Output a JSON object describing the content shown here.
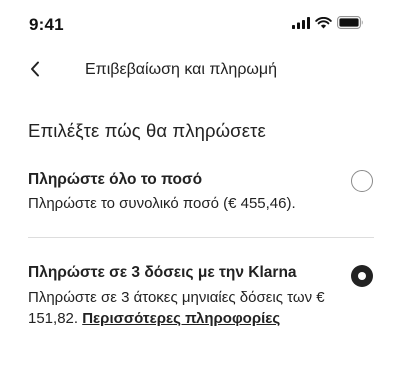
{
  "status_bar": {
    "time": "9:41",
    "icons": [
      "signal-icon",
      "wifi-icon",
      "battery-icon"
    ]
  },
  "nav": {
    "back_icon": "chevron-left-icon",
    "title": "Επιβεβαίωση και πληρωμή"
  },
  "payment": {
    "section_title": "Επιλέξτε πώς θα πληρώσετε",
    "options": [
      {
        "title": "Πληρώστε όλο το ποσό",
        "description": "Πληρώστε το συνολικό ποσό (€ 455,46).",
        "selected": false
      },
      {
        "title": "Πληρώστε σε 3 δόσεις με την Klarna",
        "description": "Πληρώστε σε 3 άτοκες μηνιαίες δόσεις των € 151,82.",
        "link_text": "Περισσότερες πληροφορίες",
        "selected": true
      }
    ]
  },
  "colors": {
    "text": "#222222",
    "divider": "#dddddd",
    "radio_border": "#8a8a8a",
    "background": "#ffffff"
  }
}
